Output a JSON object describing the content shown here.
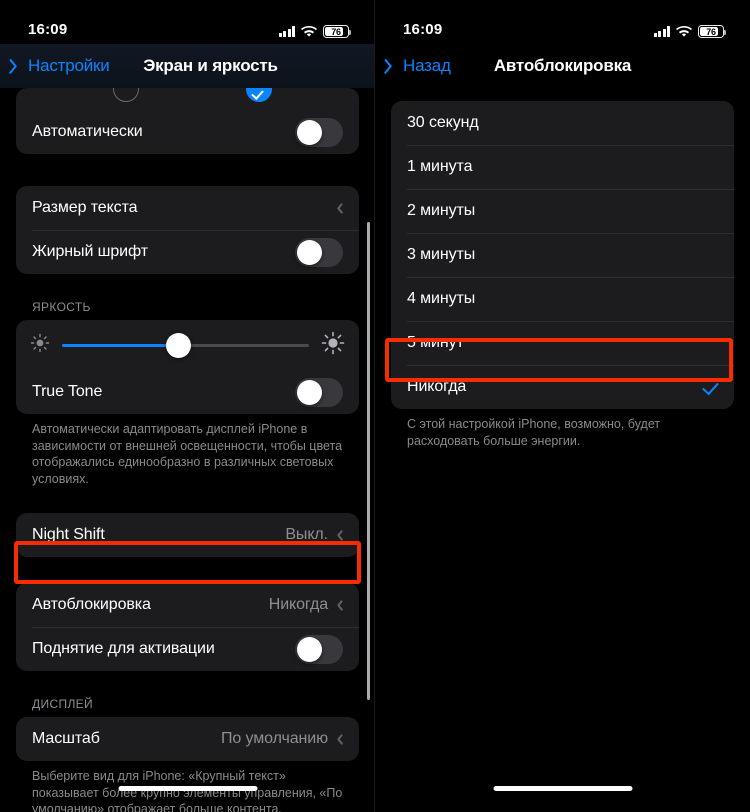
{
  "status_bar": {
    "time": "16:09",
    "battery_percent": "76",
    "icons": [
      "cellular-signal-icon",
      "wifi-icon",
      "battery-icon"
    ]
  },
  "left_screen": {
    "nav": {
      "back_label": "Настройки",
      "title": "Экран и яркость"
    },
    "appearance_row": {
      "light_option_label": "",
      "dark_option_selected": true
    },
    "auto_row": {
      "label": "Автоматически",
      "toggle": "off"
    },
    "text_group": [
      {
        "label": "Размер текста",
        "type": "disclosure",
        "value": ""
      },
      {
        "label": "Жирный шрифт",
        "type": "toggle",
        "value": "off"
      }
    ],
    "brightness": {
      "section_header": "ЯРКОСТЬ",
      "slider_percent": 47,
      "low_icon": "brightness-low-icon",
      "high_icon": "brightness-high-icon",
      "true_tone": {
        "label": "True Tone",
        "toggle": "off"
      },
      "footer": "Автоматически адаптировать дисплей iPhone в зависимости от внешней освещенности, чтобы цвета отображались единообразно в различных световых условиях."
    },
    "night_shift": {
      "label": "Night Shift",
      "value": "Выкл."
    },
    "lock_group": [
      {
        "label": "Автоблокировка",
        "type": "disclosure",
        "value": "Никогда",
        "highlighted": true
      },
      {
        "label": "Поднятие для активации",
        "type": "toggle",
        "value": "off"
      }
    ],
    "display_section": {
      "section_header": "ДИСПЛЕЙ",
      "row": {
        "label": "Масштаб",
        "value": "По умолчанию"
      },
      "footer": "Выберите вид для iPhone: «Крупный текст» показывает более крупно элементы управления, «По умолчанию» отображает больше контента."
    }
  },
  "right_screen": {
    "nav": {
      "back_label": "Назад",
      "title": "Автоблокировка"
    },
    "options": [
      {
        "label": "30 секунд",
        "selected": false
      },
      {
        "label": "1 минута",
        "selected": false
      },
      {
        "label": "2 минуты",
        "selected": false
      },
      {
        "label": "3 минуты",
        "selected": false
      },
      {
        "label": "4 минуты",
        "selected": false
      },
      {
        "label": "5 минут",
        "selected": false
      },
      {
        "label": "Никогда",
        "selected": true
      }
    ],
    "footer": "С этой настройкой iPhone, возможно, будет расходовать больше энергии."
  },
  "annotations": {
    "highlight_color": "#F82C00",
    "accent_color": "#0A84FF",
    "highlight_count": 2
  }
}
